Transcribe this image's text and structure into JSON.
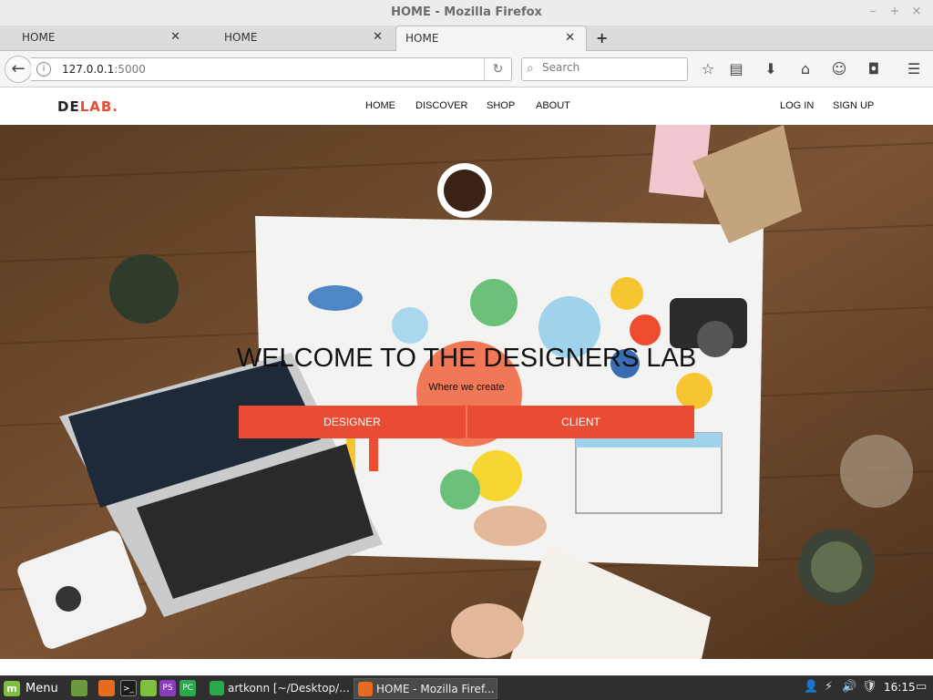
{
  "window": {
    "title": "HOME - Mozilla Firefox"
  },
  "tabs": [
    {
      "label": "HOME"
    },
    {
      "label": "HOME"
    },
    {
      "label": "HOME"
    }
  ],
  "toolbar": {
    "url_host": "127.0.0.1",
    "url_port": ":5000",
    "search_placeholder": "Search"
  },
  "site": {
    "logo_part1": "DE",
    "logo_part2": "LAB.",
    "nav": [
      "HOME",
      "DISCOVER",
      "SHOP",
      "ABOUT"
    ],
    "auth": {
      "login": "LOG IN",
      "signup": "SIGN UP"
    }
  },
  "hero": {
    "title": "WELCOME TO THE DESIGNERS LAB",
    "subtitle": "Where we create",
    "button_designer": "DESIGNER",
    "button_client": "CLIENT"
  },
  "taskbar": {
    "menu_label": "Menu",
    "windows": [
      {
        "label": "artkonn [~/Desktop/..."
      },
      {
        "label": "HOME - Mozilla Firef..."
      }
    ],
    "clock": "16:15"
  },
  "colors": {
    "accent": "#e94b35",
    "taskbar": "#2f2f2f"
  }
}
